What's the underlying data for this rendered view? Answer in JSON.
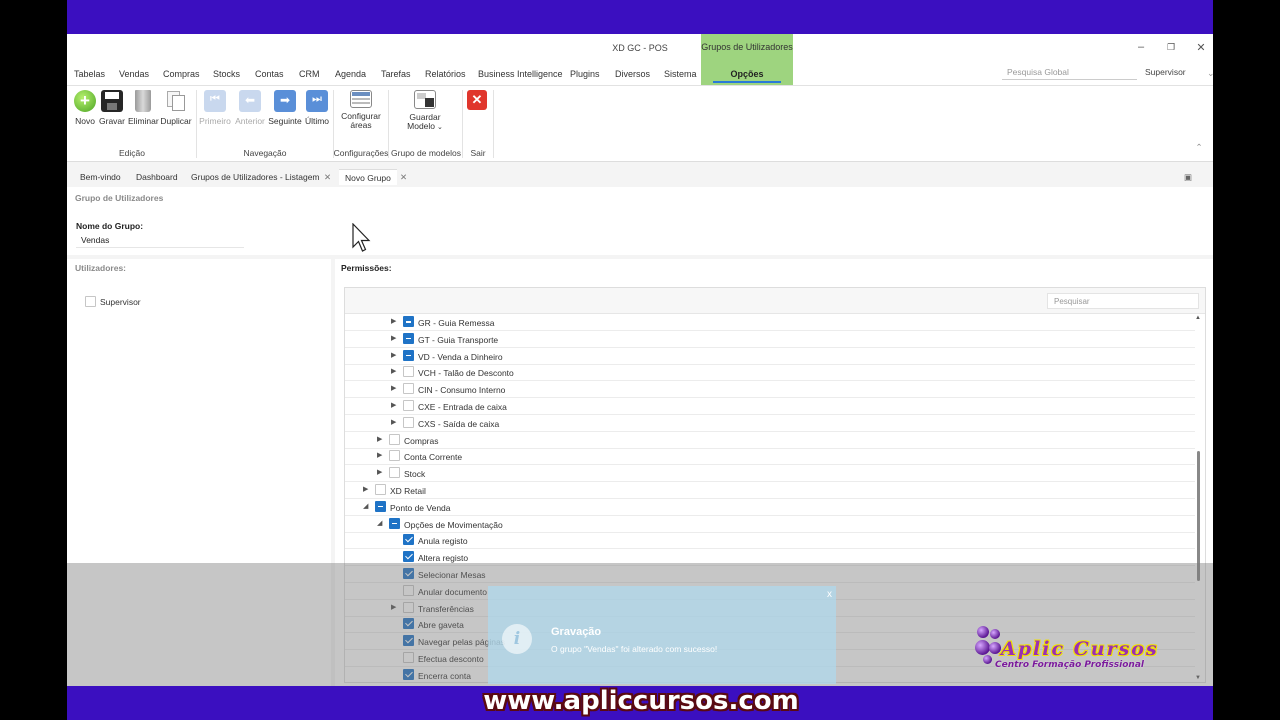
{
  "window": {
    "title": "XD GC - POS",
    "context_group": "Grupos de Utilizadores"
  },
  "menu": {
    "items": [
      "Tabelas",
      "Vendas",
      "Compras",
      "Stocks",
      "Contas",
      "CRM",
      "Agenda",
      "Tarefas",
      "Relatórios",
      "Business Intelligence",
      "Plugins",
      "Diversos",
      "Sistema"
    ],
    "active_tab": "Opções",
    "search_placeholder": "Pesquisa Global",
    "user": "Supervisor"
  },
  "ribbon": {
    "novo": "Novo",
    "gravar": "Gravar",
    "eliminar": "Eliminar",
    "duplicar": "Duplicar",
    "primeiro": "Primeiro",
    "anterior": "Anterior",
    "seguinte": "Seguinte",
    "ultimo": "Último",
    "configurar_l1": "Configurar",
    "configurar_l2": "áreas",
    "guardar_l1": "Guardar",
    "guardar_l2": "Modelo",
    "groups": {
      "edicao": "Edição",
      "navegacao": "Navegação",
      "configuracoes": "Configurações",
      "grupo_modelos": "Grupo de modelos",
      "sair": "Sair"
    }
  },
  "doc_tabs": [
    "Bem-vindo",
    "Dashboard",
    "Grupos de Utilizadores - Listagem",
    "Novo Grupo"
  ],
  "form": {
    "section_title": "Grupo de Utilizadores",
    "name_label": "Nome do Grupo:",
    "name_value": "Vendas",
    "users_label": "Utilizadores:",
    "users": [
      {
        "name": "Supervisor",
        "checked": false
      }
    ],
    "permissions_label": "Permissões:",
    "permissions_search_placeholder": "Pesquisar"
  },
  "tree": [
    {
      "label": "GR - Guia Remessa",
      "level": 3,
      "state": "partial",
      "expandable": true
    },
    {
      "label": "GT - Guia Transporte",
      "level": 3,
      "state": "partial",
      "expandable": true
    },
    {
      "label": "VD - Venda a Dinheiro",
      "level": 3,
      "state": "partial",
      "expandable": true
    },
    {
      "label": "VCH - Talão de Desconto",
      "level": 3,
      "state": "unchecked",
      "expandable": true
    },
    {
      "label": "CIN - Consumo Interno",
      "level": 3,
      "state": "unchecked",
      "expandable": true
    },
    {
      "label": "CXE - Entrada de caixa",
      "level": 3,
      "state": "unchecked",
      "expandable": true
    },
    {
      "label": "CXS - Saída de caixa",
      "level": 3,
      "state": "unchecked",
      "expandable": true
    },
    {
      "label": "Compras",
      "level": 2,
      "state": "unchecked",
      "expandable": true
    },
    {
      "label": "Conta Corrente",
      "level": 2,
      "state": "unchecked",
      "expandable": true
    },
    {
      "label": "Stock",
      "level": 2,
      "state": "unchecked",
      "expandable": true
    },
    {
      "label": "XD Retail",
      "level": 1,
      "state": "unchecked",
      "expandable": true
    },
    {
      "label": "Ponto de Venda",
      "level": 1,
      "state": "partial",
      "expandable": true,
      "expanded": true
    },
    {
      "label": "Opções de Movimentação",
      "level": 2,
      "state": "partial",
      "expandable": true,
      "expanded": true
    },
    {
      "label": "Anula registo",
      "level": 3,
      "state": "checked",
      "expandable": false
    },
    {
      "label": "Altera registo",
      "level": 3,
      "state": "checked",
      "expandable": false
    },
    {
      "label": "Selecionar Mesas",
      "level": 3,
      "state": "checked",
      "expandable": false
    },
    {
      "label": "Anular documento",
      "level": 3,
      "state": "unchecked",
      "expandable": false
    },
    {
      "label": "Transferências",
      "level": 3,
      "state": "unchecked",
      "expandable": true
    },
    {
      "label": "Abre gaveta",
      "level": 3,
      "state": "checked",
      "expandable": false
    },
    {
      "label": "Navegar pelas páginas",
      "level": 3,
      "state": "checked",
      "expandable": false
    },
    {
      "label": "Efectua desconto",
      "level": 3,
      "state": "unchecked",
      "expandable": false
    },
    {
      "label": "Encerra conta",
      "level": 3,
      "state": "checked",
      "expandable": false
    }
  ],
  "toast": {
    "title": "Gravação",
    "message": "O grupo \"Vendas\" foi alterado com sucesso!",
    "close": "x",
    "icon": "info-icon"
  },
  "branding": {
    "logo_name": "Aplic Cursos",
    "logo_tagline": "Centro Formação Profissional",
    "watermark": "www.apliccursos.com"
  },
  "colors": {
    "accent": "#1f73c6",
    "context_tab": "#9ed47f",
    "band": "#3b0fc0",
    "close_red": "#e0362c"
  }
}
